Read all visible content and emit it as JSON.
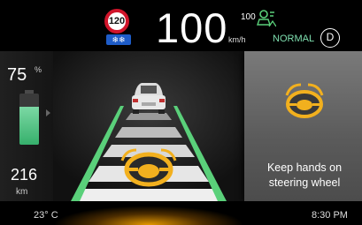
{
  "header": {
    "speed_limit_sign": "120",
    "speed_value": "100",
    "speed_unit": "km/h",
    "set_speed": "100",
    "drive_mode": "NORMAL",
    "gear": "D"
  },
  "battery": {
    "percent": "75",
    "percent_unit": "%",
    "level": 0.75,
    "range": "216",
    "range_unit": "km"
  },
  "alert": {
    "message": "Keep hands on steering wheel",
    "icon": "steering-wheel-icon"
  },
  "footer": {
    "temperature": "23° C",
    "time": "8:30 PM"
  },
  "colors": {
    "accent_green": "#7fe0b0",
    "alert_amber": "#f2b01e",
    "lane_green": "#5ad07a",
    "limit_red": "#d0142a"
  }
}
